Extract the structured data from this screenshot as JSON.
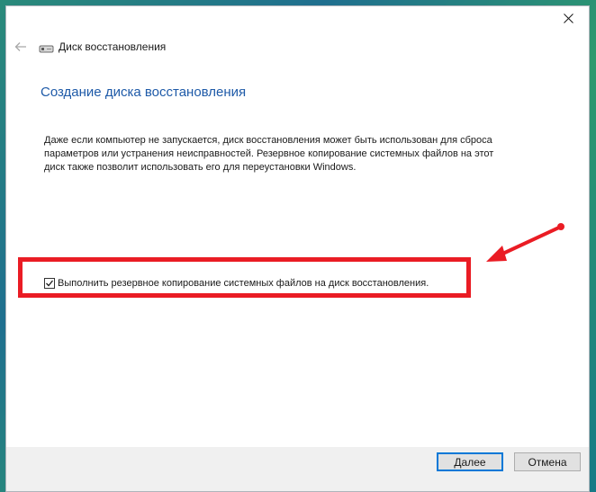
{
  "window": {
    "nav_title": "Диск восстановления",
    "icons": {
      "back": "back-arrow-icon",
      "close": "close-icon",
      "drive": "drive-icon"
    }
  },
  "main": {
    "heading": "Создание диска восстановления",
    "description": "Даже если компьютер не запускается, диск восстановления может быть использован для сброса параметров или устранения неисправностей. Резервное копирование системных файлов на этот диск также позволит использовать его для переустановки Windows.",
    "backup_checkbox": {
      "label": "Выполнить резервное копирование системных файлов на диск восстановления.",
      "checked": true
    }
  },
  "footer": {
    "next_label": "Далее",
    "cancel_label": "Отмена"
  },
  "annotation": {
    "color": "#ea1c24"
  }
}
